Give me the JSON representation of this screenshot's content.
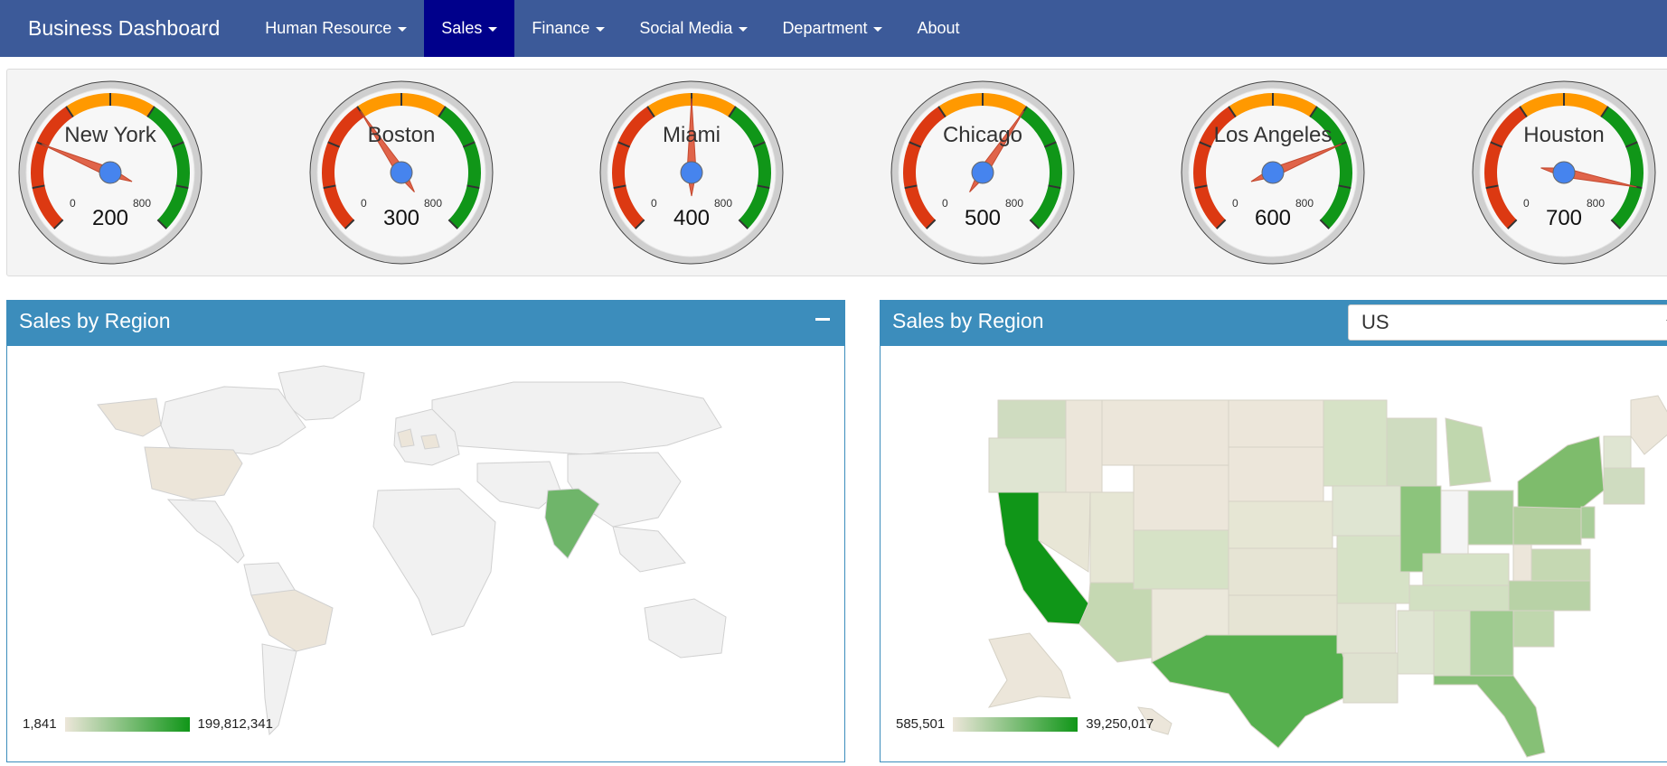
{
  "navbar": {
    "brand": "Business Dashboard",
    "items": [
      {
        "label": "Human Resource",
        "dropdown": true
      },
      {
        "label": "Sales",
        "dropdown": true,
        "active": true
      },
      {
        "label": "Finance",
        "dropdown": true
      },
      {
        "label": "Social Media",
        "dropdown": true
      },
      {
        "label": "Department",
        "dropdown": true
      },
      {
        "label": "About",
        "dropdown": false
      }
    ]
  },
  "gauges": {
    "min_label": "0",
    "max_label": "800",
    "min": 0,
    "max": 800,
    "items": [
      {
        "city": "New York",
        "value": 200
      },
      {
        "city": "Boston",
        "value": 300
      },
      {
        "city": "Miami",
        "value": 400
      },
      {
        "city": "Chicago",
        "value": 500
      },
      {
        "city": "Los Angeles",
        "value": 600
      },
      {
        "city": "Houston",
        "value": 700
      }
    ],
    "colors": {
      "red": "#dc3912",
      "yellow": "#ff9900",
      "green": "#109618",
      "needle": "#e0644a",
      "hub": "#4684ee"
    }
  },
  "panels": {
    "world": {
      "title": "Sales by Region",
      "legend_min": "1,841",
      "legend_max": "199,812,341"
    },
    "us": {
      "title": "Sales by Region",
      "select_value": "US",
      "legend_min": "585,501",
      "legend_max": "39,250,017"
    }
  },
  "colors": {
    "navbar": "#3c5a99",
    "nav_active": "#00008b",
    "panel_header": "#3c8dbc",
    "map_low": "#ece6d9",
    "map_high": "#109618"
  }
}
